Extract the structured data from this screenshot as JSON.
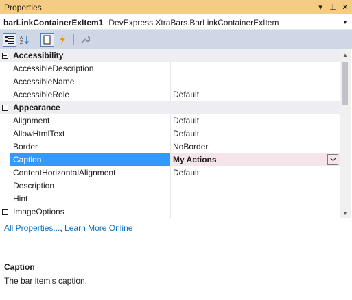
{
  "window": {
    "title": "Properties",
    "dropdown_glyph": "▾",
    "pin_glyph": "⊥",
    "close_glyph": "✕"
  },
  "object_selector": {
    "name": "barLinkContainerExItem1",
    "type": "DevExpress.XtraBars.BarLinkContainerExItem"
  },
  "toolbar": {
    "buttons": [
      {
        "icon": "categorized-icon",
        "checked": true
      },
      {
        "icon": "alphabetical-icon",
        "checked": false
      },
      {
        "icon": "properties-icon",
        "checked": true
      },
      {
        "icon": "events-icon",
        "checked": false
      },
      {
        "icon": "property-pages-icon",
        "checked": false
      }
    ]
  },
  "grid": {
    "rows": [
      {
        "kind": "category",
        "label": "Accessibility",
        "expanded": true
      },
      {
        "kind": "property",
        "name": "AccessibleDescription",
        "value": ""
      },
      {
        "kind": "property",
        "name": "AccessibleName",
        "value": ""
      },
      {
        "kind": "property",
        "name": "AccessibleRole",
        "value": "Default"
      },
      {
        "kind": "category",
        "label": "Appearance",
        "expanded": true
      },
      {
        "kind": "property",
        "name": "Alignment",
        "value": "Default"
      },
      {
        "kind": "property",
        "name": "AllowHtmlText",
        "value": "Default"
      },
      {
        "kind": "property",
        "name": "Border",
        "value": "NoBorder"
      },
      {
        "kind": "property",
        "name": "Caption",
        "value": "My Actions",
        "selected": true
      },
      {
        "kind": "property",
        "name": "ContentHorizontalAlignment",
        "value": "Default"
      },
      {
        "kind": "property",
        "name": "Description",
        "value": ""
      },
      {
        "kind": "property",
        "name": "Hint",
        "value": ""
      },
      {
        "kind": "property",
        "name": "ImageOptions",
        "value": "",
        "expandable": true
      }
    ]
  },
  "links": {
    "all_properties": "All Properties...",
    "learn_more": "Learn More Online"
  },
  "description": {
    "title": "Caption",
    "text": "The bar item's caption."
  },
  "colors": {
    "title_bar": "#f5cc84",
    "toolbar": "#cfd6e5",
    "selection": "#3399ff",
    "link": "#0e70c0"
  }
}
